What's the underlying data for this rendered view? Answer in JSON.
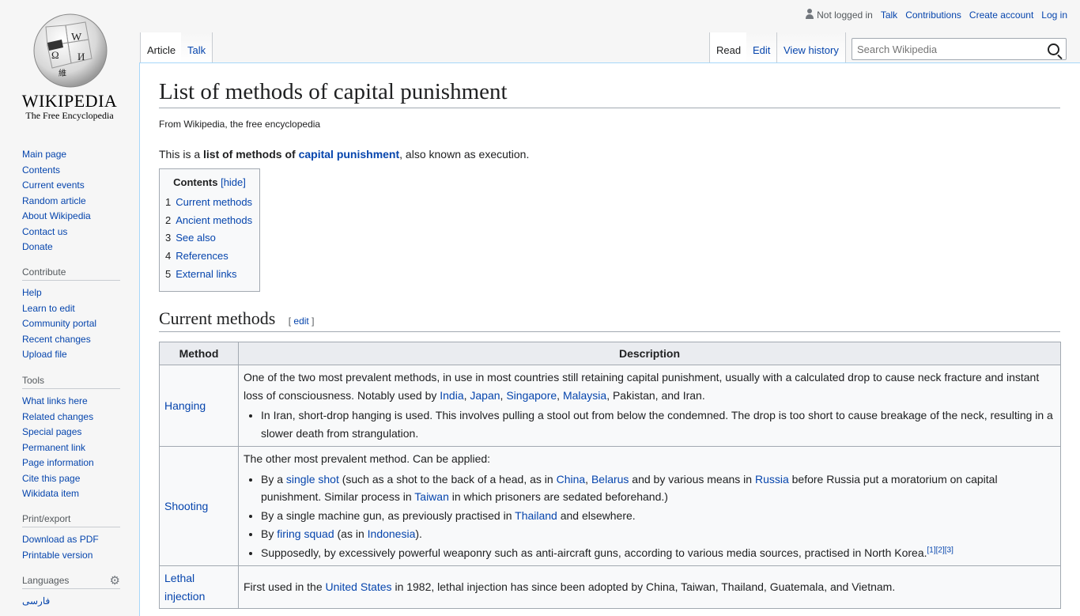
{
  "logo": {
    "wordmark": "Wikipedia",
    "tagline": "The Free Encyclopedia"
  },
  "personal": {
    "status": "Not logged in",
    "links": [
      "Talk",
      "Contributions",
      "Create account",
      "Log in"
    ]
  },
  "tabs": {
    "article": "Article",
    "talk": "Talk",
    "read": "Read",
    "edit": "Edit",
    "history": "View history"
  },
  "search": {
    "placeholder": "Search Wikipedia"
  },
  "sidebar": {
    "nav": [
      "Main page",
      "Contents",
      "Current events",
      "Random article",
      "About Wikipedia",
      "Contact us",
      "Donate"
    ],
    "contribute": {
      "heading": "Contribute",
      "items": [
        "Help",
        "Learn to edit",
        "Community portal",
        "Recent changes",
        "Upload file"
      ]
    },
    "tools": {
      "heading": "Tools",
      "items": [
        "What links here",
        "Related changes",
        "Special pages",
        "Permanent link",
        "Page information",
        "Cite this page",
        "Wikidata item"
      ]
    },
    "print": {
      "heading": "Print/export",
      "items": [
        "Download as PDF",
        "Printable version"
      ]
    },
    "languages": {
      "heading": "Languages",
      "items": [
        "فارسی"
      ]
    }
  },
  "article": {
    "title": "List of methods of capital punishment",
    "tagline": "From Wikipedia, the free encyclopedia",
    "intro": {
      "pre": "This is a ",
      "bold": "list of methods of ",
      "link": "capital punishment",
      "post": ", also known as execution."
    },
    "toc": {
      "title": "Contents",
      "hide": "[hide]",
      "items": [
        {
          "num": "1",
          "label": "Current methods"
        },
        {
          "num": "2",
          "label": "Ancient methods"
        },
        {
          "num": "3",
          "label": "See also"
        },
        {
          "num": "4",
          "label": "References"
        },
        {
          "num": "5",
          "label": "External links"
        }
      ]
    },
    "section": {
      "title": "Current methods",
      "edit": "edit"
    },
    "table": {
      "headers": [
        "Method",
        "Description"
      ],
      "hanging": {
        "method": "Hanging",
        "p1": "One of the two most prevalent methods, in use in most countries still retaining capital punishment, usually with a calculated drop to cause neck fracture and instant loss of consciousness. Notably used by ",
        "links": [
          "India",
          "Japan",
          "Singapore",
          "Malaysia"
        ],
        "p1_end": ", Pakistan, and Iran.",
        "bullet": "In Iran, short-drop hanging is used. This involves pulling a stool out from below the condemned. The drop is too short to cause breakage of the neck, resulting in a slower death from strangulation."
      },
      "shooting": {
        "method": "Shooting",
        "p1": "The other most prevalent method. Can be applied:",
        "b1_a": "By a ",
        "b1_link1": "single shot",
        "b1_b": " (such as a shot to the back of a head, as in ",
        "b1_link2": "China",
        "b1_c": ", ",
        "b1_link3": "Belarus",
        "b1_d": " and by various means in ",
        "b1_link4": "Russia",
        "b1_e": " before Russia put a moratorium on capital punishment. Similar process in ",
        "b1_link5": "Taiwan",
        "b1_f": " in which prisoners are sedated beforehand.)",
        "b2_a": "By a single machine gun, as previously practised in ",
        "b2_link": "Thailand",
        "b2_b": " and elsewhere.",
        "b3_a": "By ",
        "b3_link1": "firing squad",
        "b3_b": " (as in ",
        "b3_link2": "Indonesia",
        "b3_c": ").",
        "b4": "Supposedly, by excessively powerful weaponry such as anti-aircraft guns, according to various media sources, practised in North Korea.",
        "refs": [
          "[1]",
          "[2]",
          "[3]"
        ]
      },
      "lethal": {
        "method_1": "Lethal",
        "method_2": "injection",
        "a": "First used in the ",
        "link": "United States",
        "b": " in 1982, lethal injection has since been adopted by China, Taiwan, Thailand, Guatemala, and Vietnam."
      }
    }
  }
}
